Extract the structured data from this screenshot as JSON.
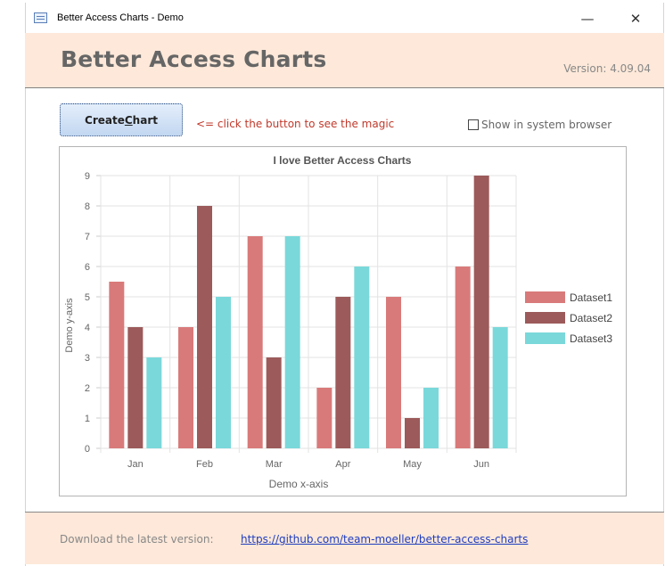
{
  "window": {
    "title": "Better Access Charts - Demo",
    "minimize_glyph": "—",
    "close_glyph": "✕"
  },
  "header": {
    "app_title": "Better Access Charts",
    "version": "Version: 4.09.04"
  },
  "toolbar": {
    "create_button_prefix": "Create ",
    "create_button_accel": "C",
    "create_button_suffix": "hart",
    "hint": "<= click the button to see the magic",
    "system_browser_label": "Show in system browser",
    "system_browser_checked": false
  },
  "chart_data": {
    "type": "bar",
    "title": "I love Better Access Charts",
    "xlabel": "Demo x-axis",
    "ylabel": "Demo y-axis",
    "categories": [
      "Jan",
      "Feb",
      "Mar",
      "Apr",
      "May",
      "Jun"
    ],
    "ylim": [
      0,
      9
    ],
    "yticks": [
      0,
      1,
      2,
      3,
      4,
      5,
      6,
      7,
      8,
      9
    ],
    "grid": true,
    "legend_position": "right",
    "series": [
      {
        "name": "Dataset1",
        "color": "#d97a7a",
        "values": [
          5.5,
          4,
          7,
          2,
          5,
          6
        ]
      },
      {
        "name": "Dataset2",
        "color": "#9c5a5a",
        "values": [
          4,
          8,
          3,
          5,
          1,
          9
        ]
      },
      {
        "name": "Dataset3",
        "color": "#7ad8da",
        "values": [
          3,
          5,
          7,
          6,
          2,
          4
        ]
      }
    ]
  },
  "footer": {
    "label": "Download the latest version:",
    "link": "https://github.com/team-moeller/better-access-charts"
  }
}
